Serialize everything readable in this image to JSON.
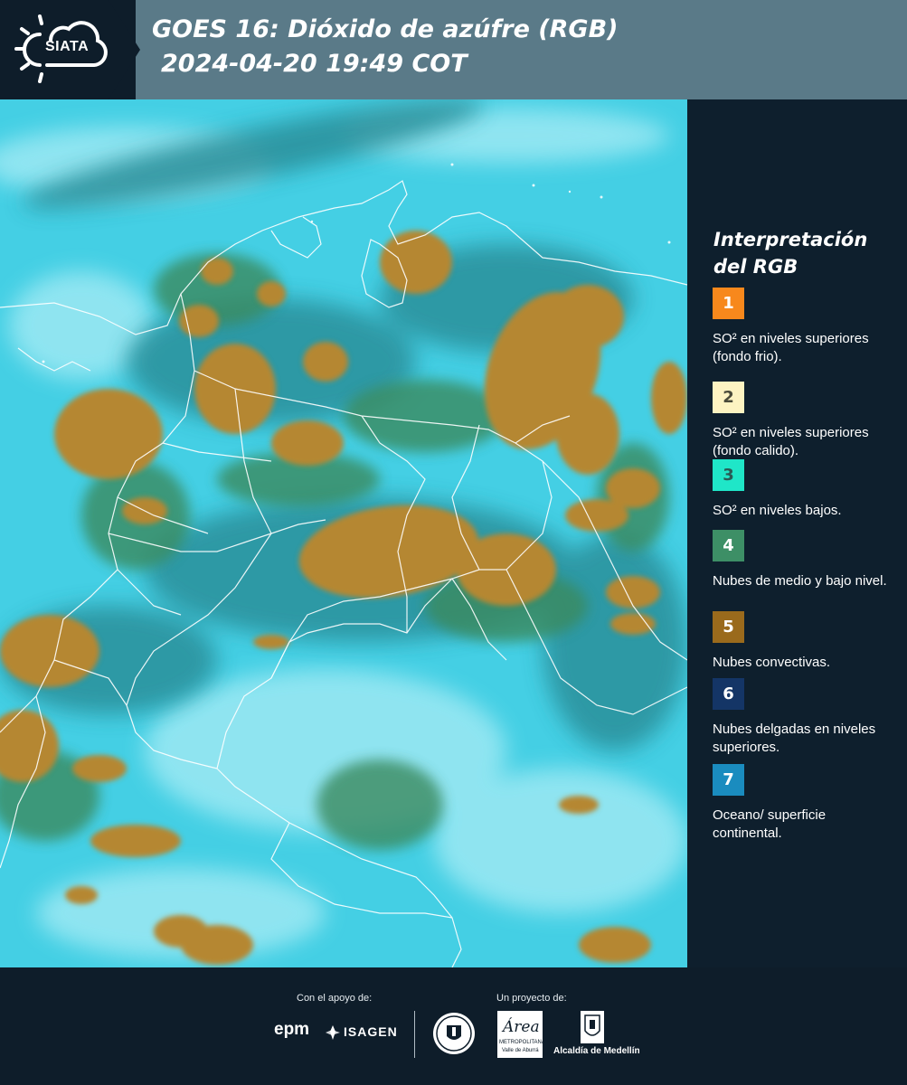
{
  "header": {
    "logo_text": "SIATA",
    "title_line1": "GOES 16: Dióxido de azúfre (RGB)",
    "title_line2": "2024-04-20 19:49 COT"
  },
  "legend": {
    "title_line1": "Interpretación",
    "title_line2": "del RGB",
    "items": [
      {
        "number": "1",
        "color": "#f7881c",
        "text_color": "#ffffff",
        "description": "SO² en niveles superiores (fondo frio)."
      },
      {
        "number": "2",
        "color": "#fdf3c2",
        "text_color": "#4a4a3a",
        "description": "SO² en niveles superiores (fondo calido)."
      },
      {
        "number": "3",
        "color": "#1fe6c8",
        "text_color": "#2a5a55",
        "description": "SO² en niveles bajos."
      },
      {
        "number": "4",
        "color": "#3d8f66",
        "text_color": "#ffffff",
        "description": "Nubes de medio y bajo nivel."
      },
      {
        "number": "5",
        "color": "#9a6a1c",
        "text_color": "#ffffff",
        "description": "Nubes convectivas."
      },
      {
        "number": "6",
        "color": "#143566",
        "text_color": "#ffffff",
        "description": "Nubes delgadas en niveles superiores."
      },
      {
        "number": "7",
        "color": "#1a8cbf",
        "text_color": "#ffffff",
        "description": "Oceano/ superficie continental."
      }
    ]
  },
  "footer": {
    "support_label": "Con el apoyo de:",
    "project_label": "Un proyecto de:",
    "sponsor_epm": "epm",
    "sponsor_isagen": "ISAGEN",
    "area_logo_text": "Área",
    "area_sub_1": "METROPOLITANA",
    "area_sub_2": "Valle de Aburrá",
    "alcaldia_text": "Alcaldía de Medellín"
  },
  "icons": {
    "logo": "sun-cloud-icon",
    "isagen": "isagen-logo-icon",
    "medellin_seal": "medellin-seal-icon",
    "alcaldia_shield": "shield-icon"
  }
}
